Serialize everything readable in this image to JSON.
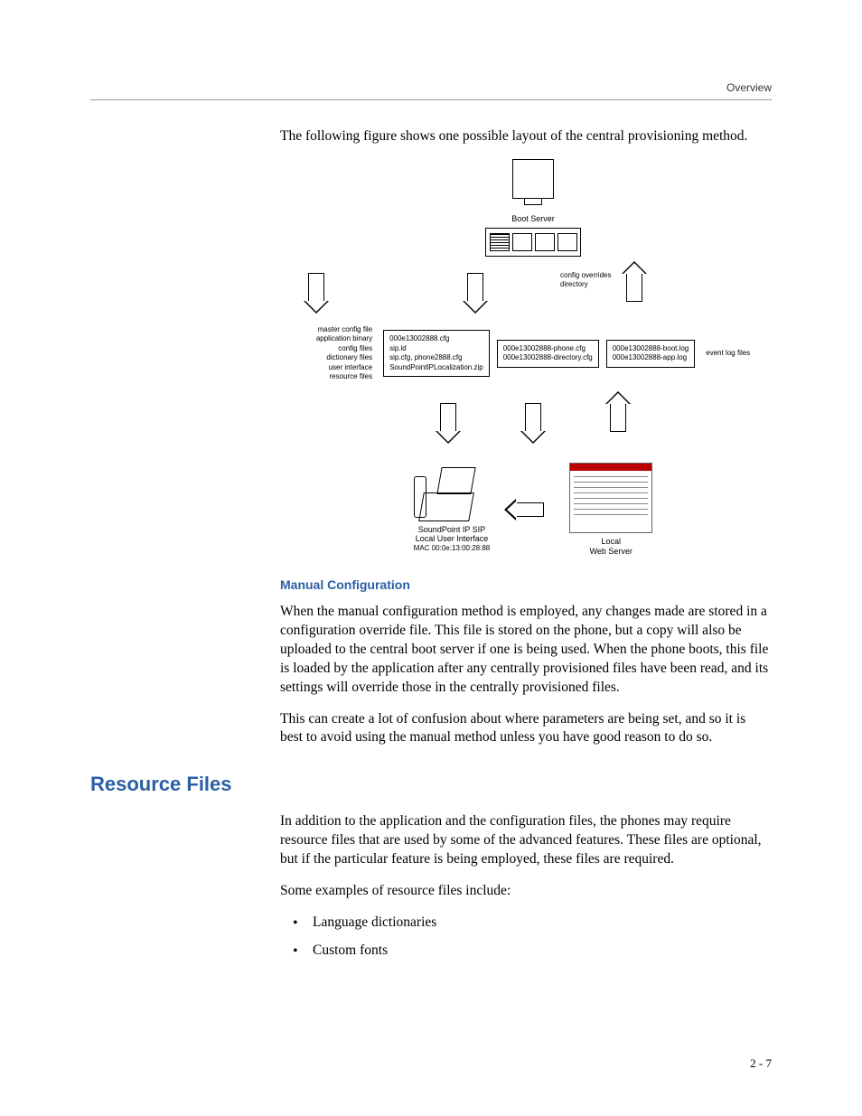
{
  "header": {
    "section": "Overview"
  },
  "intro": "The following figure shows one possible layout of the central provisioning method.",
  "figure": {
    "boot_server": "Boot Server",
    "left_labels": "master config file\napplication binary\nconfig files\ndictionary files\nuser interface\nresource files",
    "box1": "000e13002888.cfg\nsip.ld\nsip.cfg, phone2888.cfg\nSoundPointIPLocalization.zip",
    "config_dir": "config overrides\ndirectory",
    "box2": "000e13002888-phone.cfg\n000e13002888-directory.cfg",
    "box3": "000e13002888-boot.log\n000e13002888-app.log",
    "right_label": "event log files",
    "phone_line1": "SoundPoint IP SIP",
    "phone_line2": "Local User Interface",
    "phone_mac": "MAC 00:0e:13:00:28:88",
    "web_line1": "Local",
    "web_line2": "Web Server"
  },
  "manual": {
    "heading": "Manual Configuration",
    "p1": "When the manual configuration method is employed, any changes made are stored in a configuration override file. This file is stored on the phone, but a copy will also be uploaded to the central boot server if one is being used. When the phone boots, this file is loaded by the application after any centrally provisioned files have been read, and its settings will override those in the centrally provisioned files.",
    "p2": "This can create a lot of confusion about where parameters are being set, and so it is best to avoid using the manual method unless you have good reason to do so."
  },
  "resource": {
    "heading": "Resource Files",
    "p1": "In addition to the application and the configuration files, the phones may require resource files that are used by some of the advanced features. These files are optional, but if the particular feature is being employed, these files are required.",
    "p2": "Some examples of resource files include:",
    "bullets": [
      "Language dictionaries",
      "Custom fonts"
    ]
  },
  "footer": {
    "page": "2 - 7"
  }
}
